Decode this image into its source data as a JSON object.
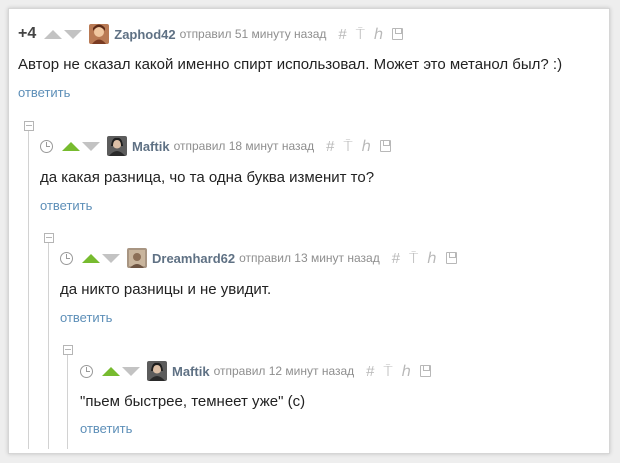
{
  "icons": {
    "hash": "#",
    "pin": "⍑",
    "branch": "ℎ"
  },
  "colors": {
    "author": "#5f7184",
    "reply_link": "#5d8fb8",
    "vote_up_active": "#77bb2f"
  },
  "comments": [
    {
      "rating": "+4",
      "author": "Zaphod42",
      "meta": "отправил 51 минуту назад",
      "text": "Автор не сказал какой именно спирт использовал. Может это метанол был? :)",
      "reply": "ответить"
    },
    {
      "author": "Maftik",
      "meta": "отправил 18 минут назад",
      "text": "да какая разница, чо та одна буква изменит то?",
      "reply": "ответить"
    },
    {
      "author": "Dreamhard62",
      "meta": "отправил 13 минут назад",
      "text": "да никто разницы и не увидит.",
      "reply": "ответить"
    },
    {
      "author": "Maftik",
      "meta": "отправил 12 минут назад",
      "text": "\"пьем быстрее, темнеет уже\" (с)",
      "reply": "ответить"
    }
  ]
}
